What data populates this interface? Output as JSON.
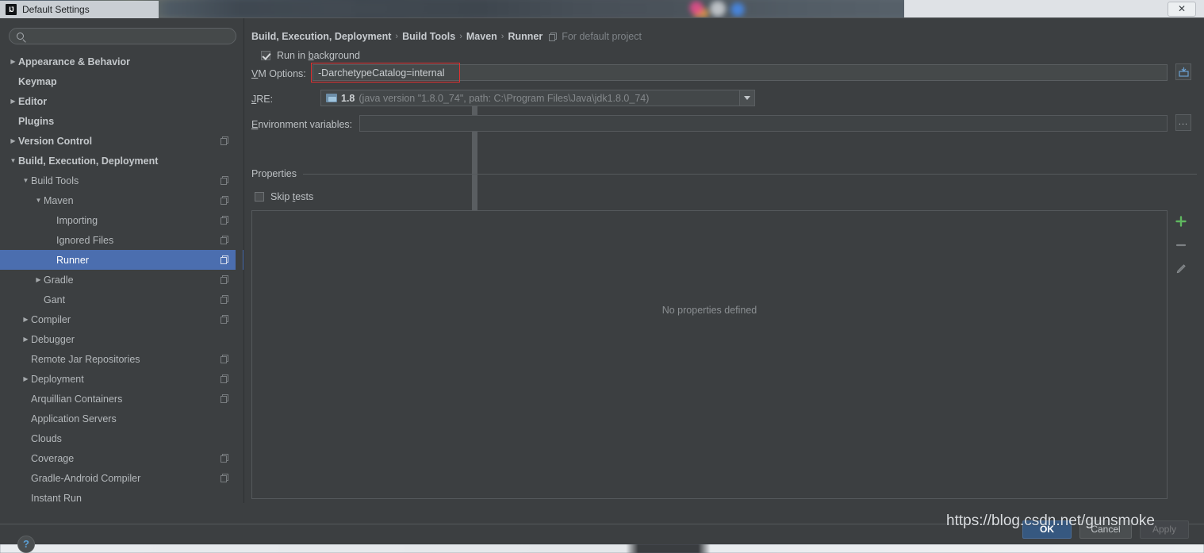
{
  "window": {
    "title": "Default Settings",
    "logo_text": "IJ",
    "close_label": "✕"
  },
  "search": {
    "value": "",
    "placeholder": "",
    "icon": "search-icon"
  },
  "sidebar": {
    "items": [
      {
        "label": "Appearance & Behavior",
        "arrow": "▶",
        "indent": 0,
        "bold": true,
        "copy": false,
        "selected": false
      },
      {
        "label": "Keymap",
        "arrow": "",
        "indent": 0,
        "bold": true,
        "copy": false,
        "selected": false
      },
      {
        "label": "Editor",
        "arrow": "▶",
        "indent": 0,
        "bold": true,
        "copy": false,
        "selected": false
      },
      {
        "label": "Plugins",
        "arrow": "",
        "indent": 0,
        "bold": true,
        "copy": false,
        "selected": false
      },
      {
        "label": "Version Control",
        "arrow": "▶",
        "indent": 0,
        "bold": true,
        "copy": true,
        "selected": false
      },
      {
        "label": "Build, Execution, Deployment",
        "arrow": "▼",
        "indent": 0,
        "bold": true,
        "copy": false,
        "selected": false
      },
      {
        "label": "Build Tools",
        "arrow": "▼",
        "indent": 1,
        "bold": false,
        "copy": true,
        "selected": false
      },
      {
        "label": "Maven",
        "arrow": "▼",
        "indent": 2,
        "bold": false,
        "copy": true,
        "selected": false
      },
      {
        "label": "Importing",
        "arrow": "",
        "indent": 3,
        "bold": false,
        "copy": true,
        "selected": false
      },
      {
        "label": "Ignored Files",
        "arrow": "",
        "indent": 3,
        "bold": false,
        "copy": true,
        "selected": false
      },
      {
        "label": "Runner",
        "arrow": "",
        "indent": 3,
        "bold": false,
        "copy": true,
        "selected": true
      },
      {
        "label": "Gradle",
        "arrow": "▶",
        "indent": 2,
        "bold": false,
        "copy": true,
        "selected": false
      },
      {
        "label": "Gant",
        "arrow": "",
        "indent": 2,
        "bold": false,
        "copy": true,
        "selected": false
      },
      {
        "label": "Compiler",
        "arrow": "▶",
        "indent": 1,
        "bold": false,
        "copy": true,
        "selected": false
      },
      {
        "label": "Debugger",
        "arrow": "▶",
        "indent": 1,
        "bold": false,
        "copy": false,
        "selected": false
      },
      {
        "label": "Remote Jar Repositories",
        "arrow": "",
        "indent": 1,
        "bold": false,
        "copy": true,
        "selected": false
      },
      {
        "label": "Deployment",
        "arrow": "▶",
        "indent": 1,
        "bold": false,
        "copy": true,
        "selected": false
      },
      {
        "label": "Arquillian Containers",
        "arrow": "",
        "indent": 1,
        "bold": false,
        "copy": true,
        "selected": false
      },
      {
        "label": "Application Servers",
        "arrow": "",
        "indent": 1,
        "bold": false,
        "copy": false,
        "selected": false
      },
      {
        "label": "Clouds",
        "arrow": "",
        "indent": 1,
        "bold": false,
        "copy": false,
        "selected": false
      },
      {
        "label": "Coverage",
        "arrow": "",
        "indent": 1,
        "bold": false,
        "copy": true,
        "selected": false
      },
      {
        "label": "Gradle-Android Compiler",
        "arrow": "",
        "indent": 1,
        "bold": false,
        "copy": true,
        "selected": false
      },
      {
        "label": "Instant Run",
        "arrow": "",
        "indent": 1,
        "bold": false,
        "copy": false,
        "selected": false
      }
    ]
  },
  "content": {
    "breadcrumb": {
      "parts": [
        "Build, Execution, Deployment",
        "Build Tools",
        "Maven",
        "Runner"
      ],
      "separator": "›",
      "note": "For default project"
    },
    "run_in_background": {
      "label_before": "Run in ",
      "label_mnemonic": "b",
      "label_after": "ackground",
      "checked": true
    },
    "vm_options": {
      "label_mnemonic": "V",
      "label_rest": "M Options:",
      "value": "-DarchetypeCatalog=internal",
      "highlight_color": "#e03030",
      "expand_icon": "expand-editor-icon"
    },
    "jre": {
      "label_mnemonic": "J",
      "label_rest": "RE:",
      "version": "1.8",
      "detail": "(java version \"1.8.0_74\", path: C:\\Program Files\\Java\\jdk1.8.0_74)",
      "dropdown_icon": "chevron-down-icon"
    },
    "environment_variables": {
      "label_mnemonic": "E",
      "label_rest": "nvironment variables:",
      "value": "",
      "browse_label": "..."
    },
    "properties_group_title": "Properties",
    "skip_tests": {
      "label_before": "Skip ",
      "label_mnemonic": "t",
      "label_after": "ests",
      "checked": false
    },
    "properties_panel": {
      "empty_text": "No properties defined",
      "toolbar": {
        "add_label": "+",
        "add_color": "#5fb75f",
        "remove_label": "−",
        "edit_icon": "pencil-icon"
      }
    }
  },
  "footer": {
    "help_label": "?",
    "ok_label": "OK",
    "cancel_label": "Cancel",
    "apply_label": "Apply",
    "apply_disabled": true
  },
  "watermark": {
    "text": "https://blog.csdn.net/gunsmoke"
  }
}
